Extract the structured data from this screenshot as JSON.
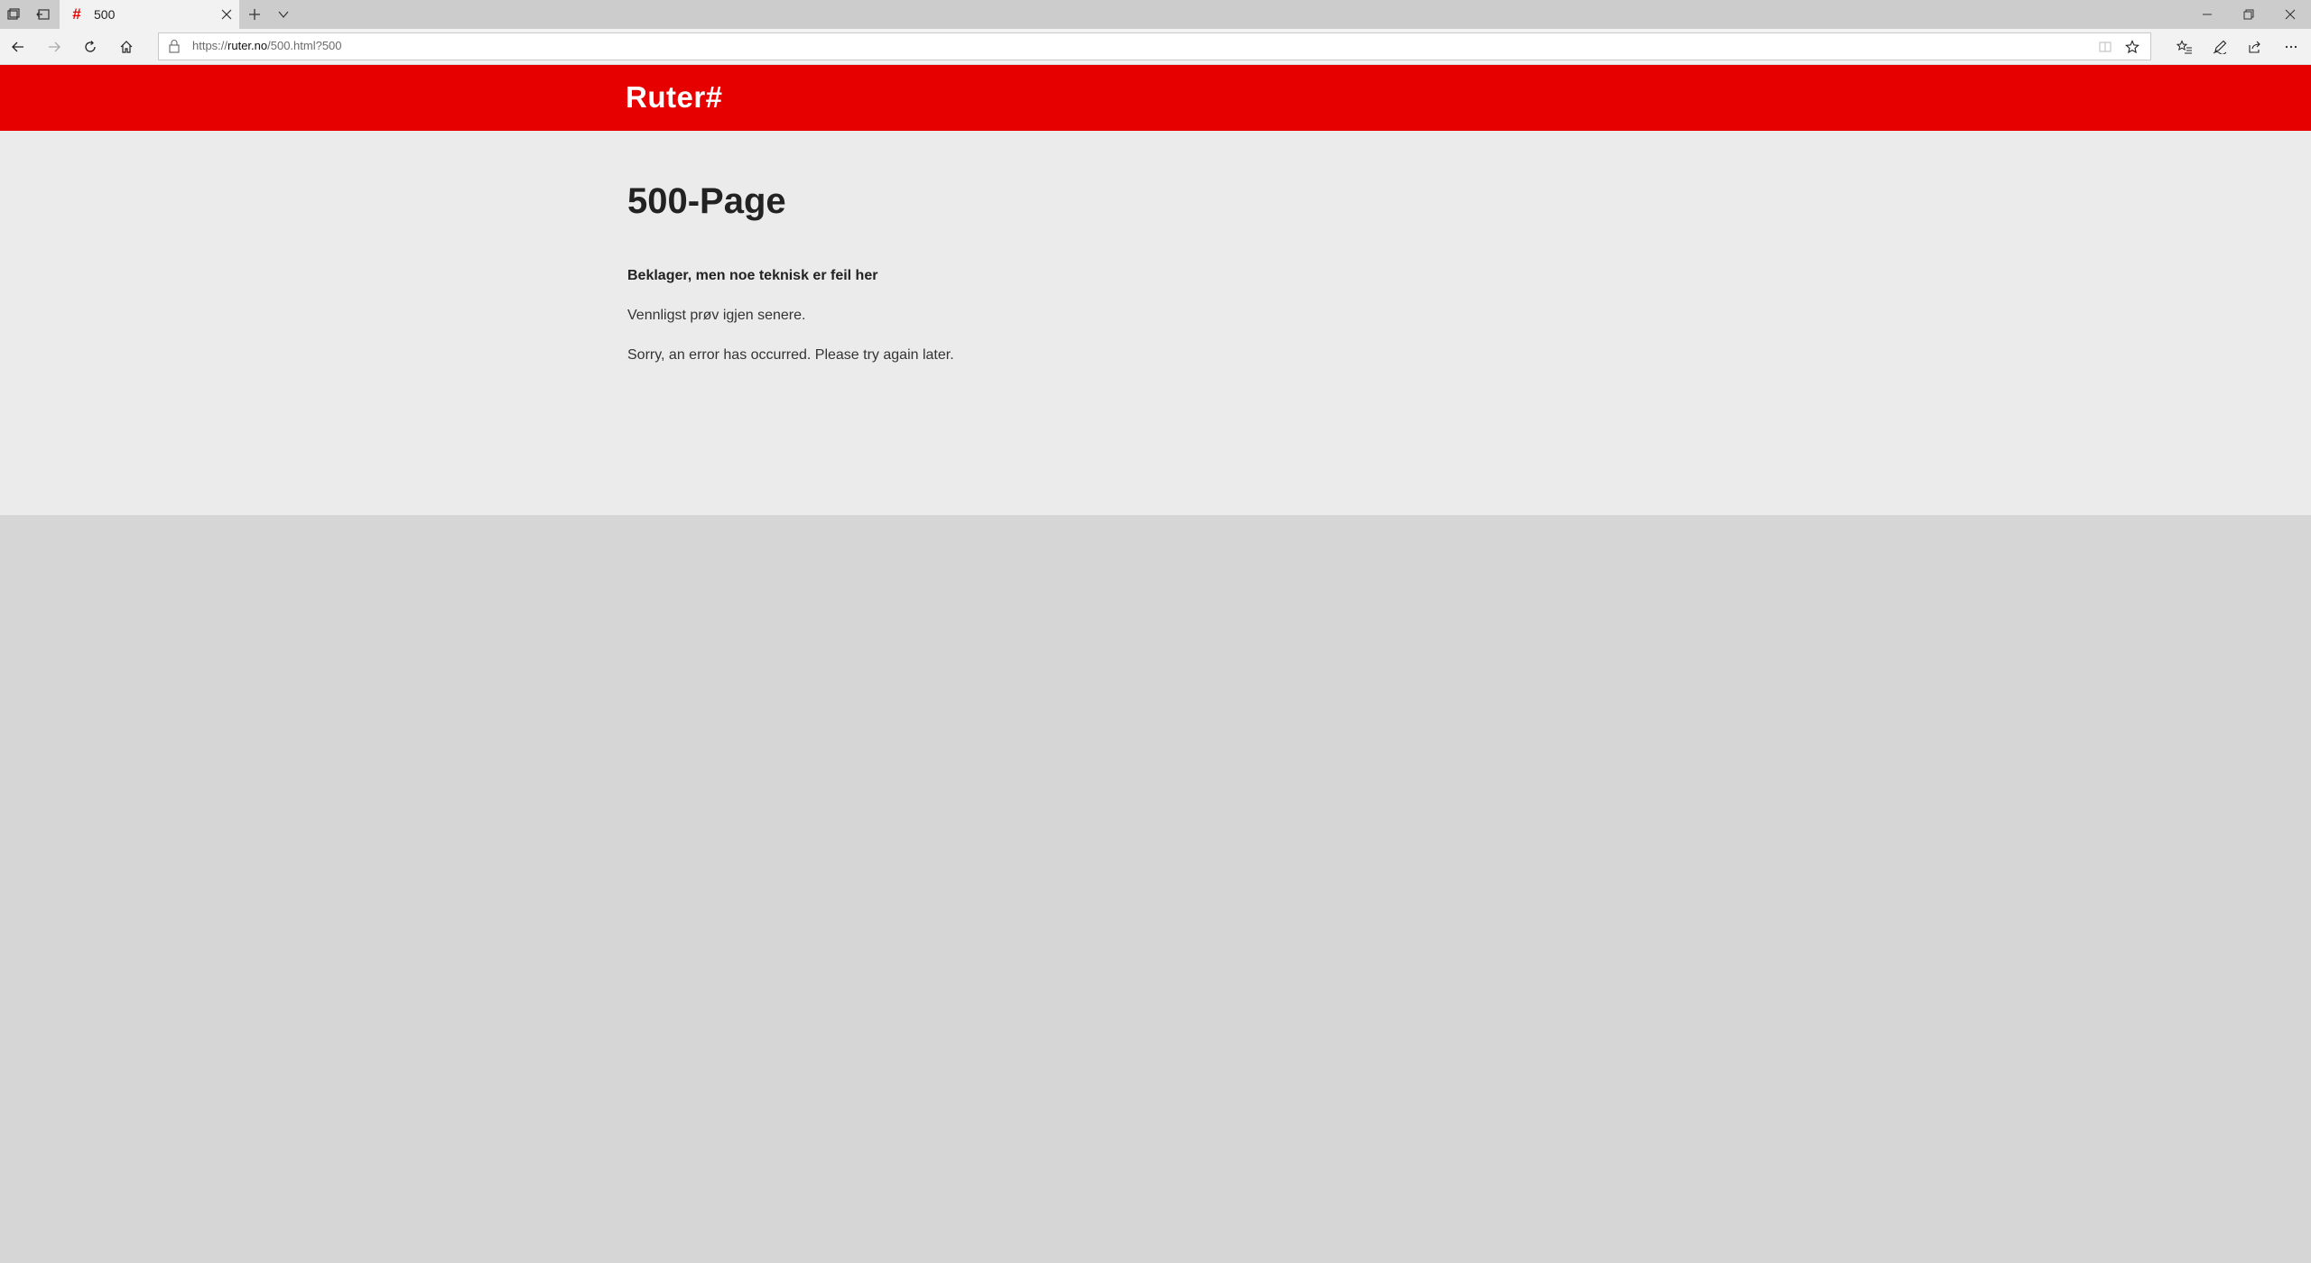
{
  "browser": {
    "tab": {
      "title": "500",
      "favicon": "#"
    },
    "url": {
      "scheme": "https://",
      "domain": "ruter.no",
      "path": "/500.html?500"
    },
    "accent": "#e60000"
  },
  "header": {
    "logo": "Ruter#",
    "color": "#e60000"
  },
  "main": {
    "title": "500-Page",
    "heading_bold": "Beklager, men noe teknisk er feil her",
    "paragraph_no": "Vennligst prøv igjen senere.",
    "paragraph_en": "Sorry, an error has occurred. Please try again later."
  },
  "icons": [
    "tab-preview-icon",
    "set-aside-tabs-icon",
    "close-icon",
    "new-tab-icon",
    "tab-dropdown-icon",
    "minimize-icon",
    "restore-icon",
    "back-arrow-icon",
    "forward-arrow-icon",
    "refresh-icon",
    "home-icon",
    "lock-icon",
    "reading-view-icon",
    "favorite-star-icon",
    "favorites-hub-icon",
    "pen-icon",
    "share-icon",
    "more-icon"
  ]
}
